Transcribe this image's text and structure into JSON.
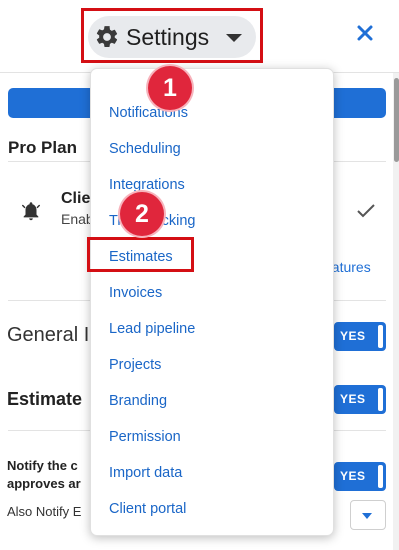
{
  "header": {
    "title": "Settings",
    "close_icon": "close-icon",
    "gear_icon": "gear-icon"
  },
  "page": {
    "pro_plan": "Pro Plan",
    "client_title": "Clie",
    "client_subtitle": "Enab",
    "features_link": "eatures",
    "general_label": "General I",
    "estimate_label": "Estimate",
    "notify_label_line1": "Notify the c",
    "notify_label_line2": "approves ar",
    "also_notify": "Also Notify E"
  },
  "toggles": {
    "general": "YES",
    "estimate": "YES",
    "notify": "YES"
  },
  "dropdown": {
    "items": [
      "Notifications",
      "Scheduling",
      "Integrations",
      "Time tracking",
      "Estimates",
      "Invoices",
      "Lead pipeline",
      "Projects",
      "Branding",
      "Permission",
      "Import data",
      "Client portal"
    ]
  },
  "annotations": {
    "step1": "1",
    "step2": "2"
  },
  "colors": {
    "accent": "#1f6fd6",
    "link": "#1a66c7",
    "highlight_red": "#d40f14",
    "badge_red": "#e0263c"
  }
}
